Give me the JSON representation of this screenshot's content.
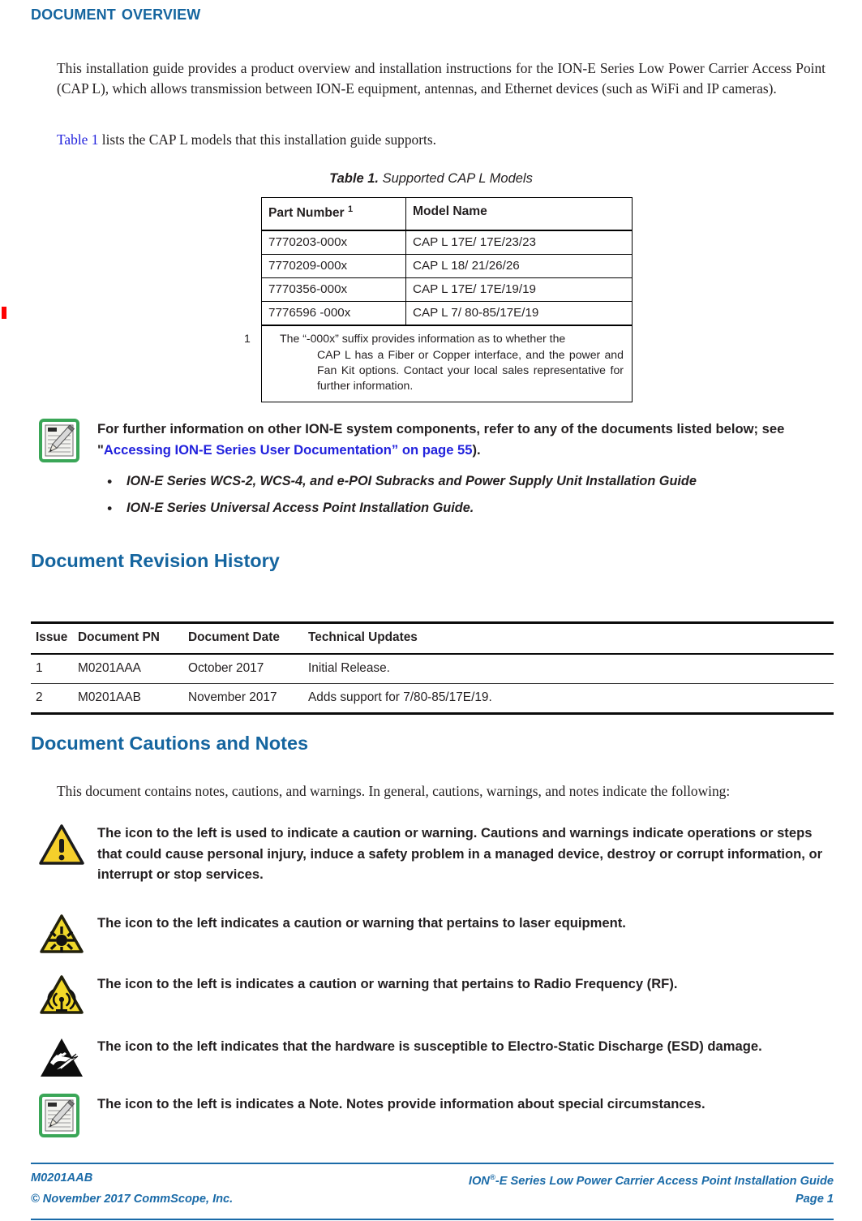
{
  "headings": {
    "doc_overview": "Document Overview",
    "revision_history": "Document Revision History",
    "cautions_notes": "Document Cautions and Notes"
  },
  "body": {
    "intro": "This installation guide provides a product overview and installation instructions for the ION-E Series Low Power Carrier Access Point (CAP L), which allows transmission between ION-E equipment, antennas, and Ethernet devices (such as WiFi and IP cameras).",
    "table_ref_link": "Table 1",
    "table_ref_rest": " lists the CAP L models that this installation guide supports.",
    "cautions_intro": "This document contains notes, cautions, and warnings. In general, cautions, warnings, and notes indicate the following:"
  },
  "table1": {
    "caption_label": "Table 1.",
    "caption_title": "Supported CAP L Models",
    "columns": [
      "Part Number",
      "Model Name"
    ],
    "header_footnote_marker": "1",
    "rows": [
      {
        "part_number": "7770203-000x",
        "model_name": "CAP L  17E/ 17E/23/23"
      },
      {
        "part_number": "7770209-000x",
        "model_name": "CAP L  18/ 21/26/26"
      },
      {
        "part_number": "7770356-000x",
        "model_name": "CAP L  17E/ 17E/19/19"
      },
      {
        "part_number": "7776596 -000x",
        "model_name": "CAP L  7/ 80-85/17E/19"
      }
    ],
    "footnote_number": "1",
    "footnote_line1": "The “-000x” suffix provides information as to whether the",
    "footnote_rest": "CAP  L has a Fiber or Copper interface, and the power and Fan Kit options. Contact your local sales representative for further information."
  },
  "note_box": {
    "icon": "note-pencil-icon",
    "text_before_link": "For further information on other ION-E system components, refer to any of the documents listed below; see \"",
    "link_text": "Accessing ION-E Series User Documentation” on page 55",
    "text_after_link": ").",
    "documents": [
      "ION-E Series WCS-2, WCS-4, and e-POI Subracks and Power Supply Unit Installation Guide",
      "ION-E Series Universal Access Point Installation Guide."
    ]
  },
  "revision_table": {
    "columns": [
      "Issue",
      "Document PN",
      "Document Date",
      "Technical Updates"
    ],
    "rows": [
      {
        "issue": "1",
        "pn": "M0201AAA",
        "date": "October 2017",
        "updates": "Initial Release."
      },
      {
        "issue": "2",
        "pn": "M0201AAB",
        "date": "November 2017",
        "updates": "Adds support for 7/80-85/17E/19."
      }
    ]
  },
  "caution_rows": [
    {
      "icon": "warning-triangle-icon",
      "text": "The icon to the left is used to indicate a caution or warning. Cautions and warnings indicate operations or steps that could cause personal injury, induce a safety problem in a managed device, destroy or corrupt information, or interrupt or stop services."
    },
    {
      "icon": "laser-warning-icon",
      "text": "The icon to the left indicates a caution or warning that pertains to laser equipment."
    },
    {
      "icon": "radio-frequency-warning-icon",
      "text": "The icon to the left is indicates a caution or warning that pertains to Radio Frequency (RF)."
    },
    {
      "icon": "esd-warning-icon",
      "text": "The icon to the left indicates that the hardware is susceptible to Electro-Static Discharge (ESD) damage."
    },
    {
      "icon": "note-pencil-icon",
      "text": "The icon to the left is indicates a Note. Notes provide information about special circumstances."
    }
  ],
  "footer": {
    "left_line1": "M0201AAB",
    "left_line2": "© November 2017 CommScope, Inc.",
    "right_line1_pre": "ION",
    "right_line1_sup": "®",
    "right_line1_post": "-E Series Low Power Carrier Access Point Installation Guide",
    "right_line2": "Page 1"
  },
  "colors": {
    "heading_blue": "#15659f",
    "link_blue": "#2222dd",
    "footer_blue": "#1b6ba8",
    "change_bar_red": "#fe0000",
    "warning_yellow": "#f5cf2b",
    "note_green": "#3aa657"
  }
}
